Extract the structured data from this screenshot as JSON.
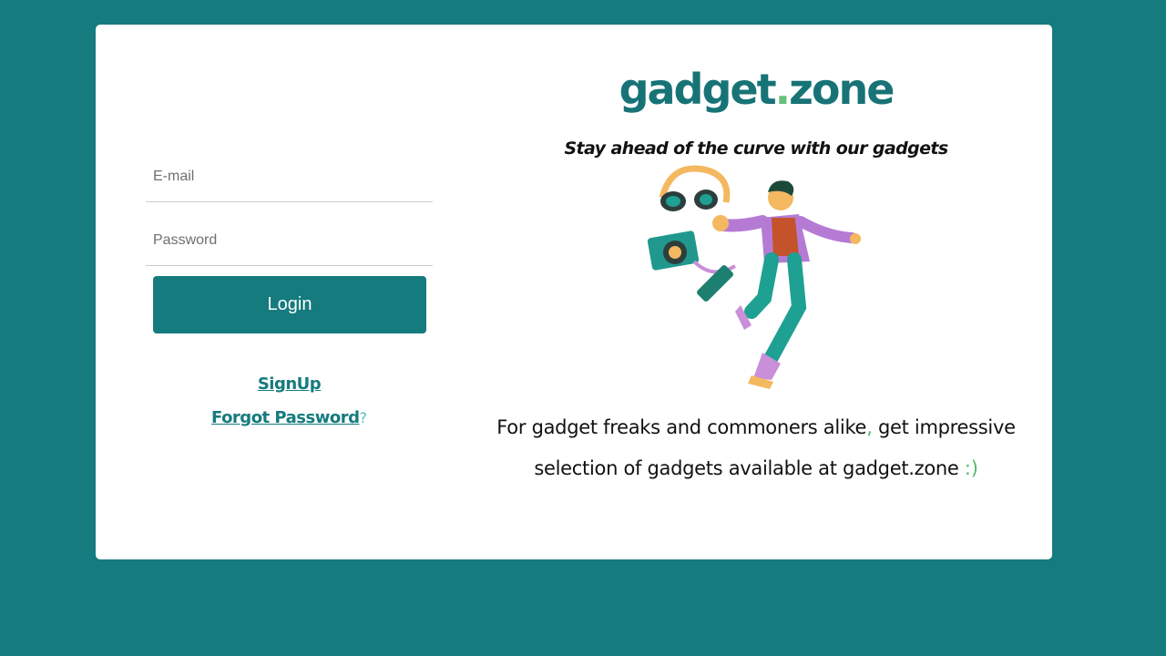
{
  "login": {
    "email_placeholder": "E-mail",
    "password_placeholder": "Password",
    "login_label": "Login",
    "signup_label": "SignUp",
    "forgot_label": "Forgot Password",
    "forgot_suffix": "?"
  },
  "brand": {
    "logo_part1": "gadget",
    "logo_dot": ".",
    "logo_part2": "zone",
    "tagline": "Stay ahead of the curve with our gadgets",
    "desc_part1": "For gadget freaks and commoners alike",
    "desc_comma": ",",
    "desc_part2": " get impressive",
    "desc_part3": "selection of gadgets available at gadget.zone",
    "desc_smiley": ":)"
  },
  "colors": {
    "background": "#157b7e",
    "card": "#ffffff",
    "primary": "#157b7e",
    "accent_green": "#66c17a"
  }
}
